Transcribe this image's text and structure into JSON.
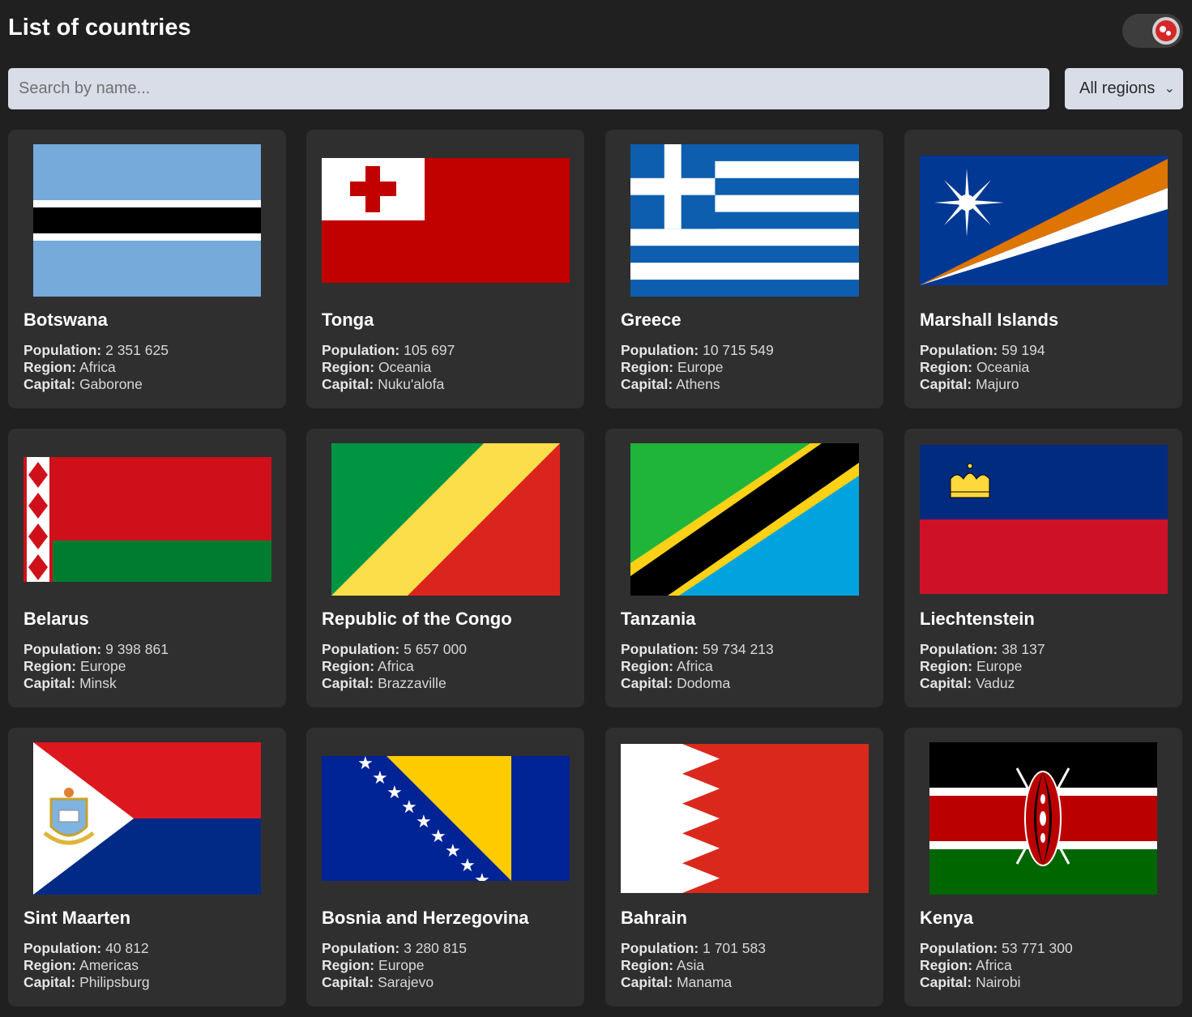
{
  "header": {
    "title": "List of countries"
  },
  "search": {
    "placeholder": "Search by name..."
  },
  "filter": {
    "selected": "All regions"
  },
  "labels": {
    "population": "Population:",
    "region": "Region:",
    "capital": "Capital:"
  },
  "countries": [
    {
      "name": "Botswana",
      "population": "2 351 625",
      "region": "Africa",
      "capital": "Gaborone"
    },
    {
      "name": "Tonga",
      "population": "105 697",
      "region": "Oceania",
      "capital": "Nuku'alofa"
    },
    {
      "name": "Greece",
      "population": "10 715 549",
      "region": "Europe",
      "capital": "Athens"
    },
    {
      "name": "Marshall Islands",
      "population": "59 194",
      "region": "Oceania",
      "capital": "Majuro"
    },
    {
      "name": "Belarus",
      "population": "9 398 861",
      "region": "Europe",
      "capital": "Minsk"
    },
    {
      "name": "Republic of the Congo",
      "population": "5 657 000",
      "region": "Africa",
      "capital": "Brazzaville"
    },
    {
      "name": "Tanzania",
      "population": "59 734 213",
      "region": "Africa",
      "capital": "Dodoma"
    },
    {
      "name": "Liechtenstein",
      "population": "38 137",
      "region": "Europe",
      "capital": "Vaduz"
    },
    {
      "name": "Sint Maarten",
      "population": "40 812",
      "region": "Americas",
      "capital": "Philipsburg"
    },
    {
      "name": "Bosnia and Herzegovina",
      "population": "3 280 815",
      "region": "Europe",
      "capital": "Sarajevo"
    },
    {
      "name": "Bahrain",
      "population": "1 701 583",
      "region": "Asia",
      "capital": "Manama"
    },
    {
      "name": "Kenya",
      "population": "53 771 300",
      "region": "Africa",
      "capital": "Nairobi"
    }
  ]
}
